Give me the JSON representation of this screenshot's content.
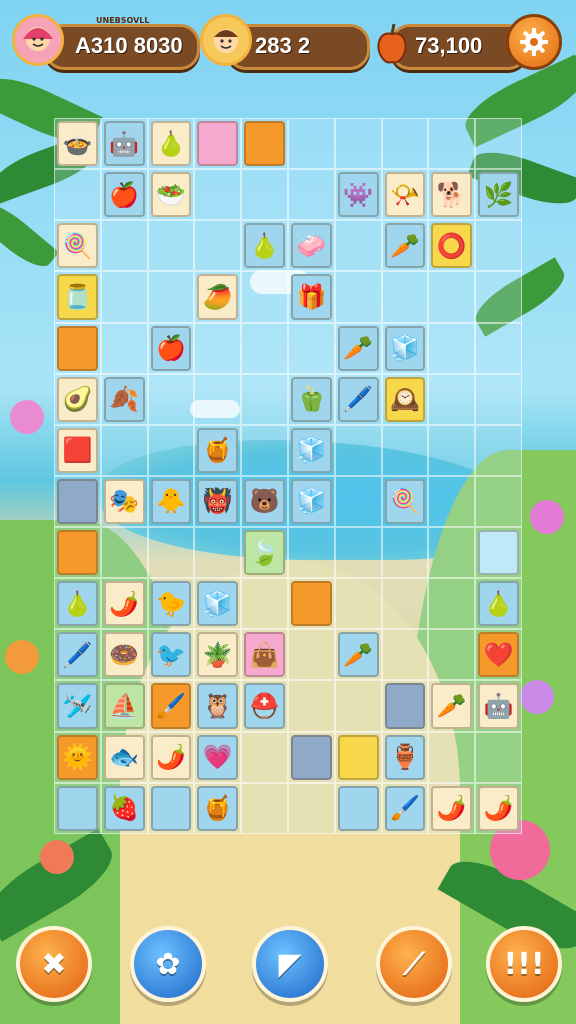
{
  "hud": {
    "player": {
      "score_label": "A310 8030",
      "caption": "UNEBSOVLL"
    },
    "opponent": {
      "score_label": "283 2"
    },
    "coins": {
      "value_label": "73,100"
    }
  },
  "colors": {
    "wood": "#7a4a25",
    "orange": "#f59a2a",
    "blue": "#9fd6ee",
    "pink": "#f6a9cf",
    "cream": "#fbecc9",
    "yellow": "#f6d84a"
  },
  "board": {
    "cols": 10,
    "rows": 14,
    "tiles": [
      {
        "r": 0,
        "c": 0,
        "color": "cream",
        "icon": "pot",
        "glyph": "🍲"
      },
      {
        "r": 0,
        "c": 1,
        "color": "blue",
        "icon": "robot",
        "glyph": "🤖"
      },
      {
        "r": 0,
        "c": 2,
        "color": "cream",
        "icon": "pear",
        "glyph": "🍐"
      },
      {
        "r": 0,
        "c": 3,
        "color": "pink",
        "icon": "blank",
        "glyph": ""
      },
      {
        "r": 0,
        "c": 4,
        "color": "orange",
        "icon": "blank",
        "glyph": ""
      },
      {
        "r": 1,
        "c": 1,
        "color": "blue",
        "icon": "pomegranate",
        "glyph": "🍎"
      },
      {
        "r": 1,
        "c": 2,
        "color": "cream",
        "icon": "bowl",
        "glyph": "🥗"
      },
      {
        "r": 1,
        "c": 6,
        "color": "blue",
        "icon": "monster",
        "glyph": "👾"
      },
      {
        "r": 1,
        "c": 7,
        "color": "cream",
        "icon": "horn",
        "glyph": "📯"
      },
      {
        "r": 1,
        "c": 8,
        "color": "cream",
        "icon": "animal",
        "glyph": "🐕"
      },
      {
        "r": 1,
        "c": 9,
        "color": "blue",
        "icon": "leaf",
        "glyph": "🌿"
      },
      {
        "r": 2,
        "c": 0,
        "color": "cream",
        "icon": "lollipop",
        "glyph": "🍭"
      },
      {
        "r": 2,
        "c": 4,
        "color": "blue",
        "icon": "gourd",
        "glyph": "🍐"
      },
      {
        "r": 2,
        "c": 5,
        "color": "blue",
        "icon": "eraser",
        "glyph": "🧼"
      },
      {
        "r": 2,
        "c": 7,
        "color": "blue",
        "icon": "carrot",
        "glyph": "🥕"
      },
      {
        "r": 2,
        "c": 8,
        "color": "yellow",
        "icon": "ring",
        "glyph": "⭕"
      },
      {
        "r": 3,
        "c": 0,
        "color": "yellow",
        "icon": "jar",
        "glyph": "🫙"
      },
      {
        "r": 3,
        "c": 3,
        "color": "cream",
        "icon": "mango",
        "glyph": "🥭"
      },
      {
        "r": 3,
        "c": 5,
        "color": "blue",
        "icon": "box",
        "glyph": "🎁"
      },
      {
        "r": 4,
        "c": 0,
        "color": "orange",
        "icon": "blank",
        "glyph": ""
      },
      {
        "r": 4,
        "c": 2,
        "color": "blue",
        "icon": "apple",
        "glyph": "🍎"
      },
      {
        "r": 4,
        "c": 6,
        "color": "blue",
        "icon": "carrot",
        "glyph": "🥕"
      },
      {
        "r": 4,
        "c": 7,
        "color": "blue",
        "icon": "cube",
        "glyph": "🧊"
      },
      {
        "r": 5,
        "c": 0,
        "color": "cream",
        "icon": "avocado",
        "glyph": "🥑"
      },
      {
        "r": 5,
        "c": 1,
        "color": "blue",
        "icon": "leaf",
        "glyph": "🍂"
      },
      {
        "r": 5,
        "c": 5,
        "color": "blue",
        "icon": "pepper",
        "glyph": "🫑"
      },
      {
        "r": 5,
        "c": 6,
        "color": "blue",
        "icon": "pen",
        "glyph": "🖊️"
      },
      {
        "r": 5,
        "c": 7,
        "color": "yellow",
        "icon": "clock",
        "glyph": "🕰️"
      },
      {
        "r": 6,
        "c": 0,
        "color": "cream",
        "icon": "cube-red",
        "glyph": "🟥"
      },
      {
        "r": 6,
        "c": 3,
        "color": "blue",
        "icon": "honey",
        "glyph": "🍯"
      },
      {
        "r": 6,
        "c": 5,
        "color": "blue",
        "icon": "cube",
        "glyph": "🧊"
      },
      {
        "r": 7,
        "c": 0,
        "color": "slate",
        "icon": "blank",
        "glyph": ""
      },
      {
        "r": 7,
        "c": 1,
        "color": "cream",
        "icon": "mask",
        "glyph": "🎭"
      },
      {
        "r": 7,
        "c": 2,
        "color": "blue",
        "icon": "bird",
        "glyph": "🐥"
      },
      {
        "r": 7,
        "c": 3,
        "color": "blue",
        "icon": "monster",
        "glyph": "👹"
      },
      {
        "r": 7,
        "c": 4,
        "color": "blue",
        "icon": "creature",
        "glyph": "🐻"
      },
      {
        "r": 7,
        "c": 5,
        "color": "blue",
        "icon": "cube",
        "glyph": "🧊"
      },
      {
        "r": 7,
        "c": 7,
        "color": "blue",
        "icon": "lollipop",
        "glyph": "🍭"
      },
      {
        "r": 8,
        "c": 0,
        "color": "orange",
        "icon": "blank",
        "glyph": ""
      },
      {
        "r": 8,
        "c": 4,
        "color": "green",
        "icon": "leaf",
        "glyph": "🍃"
      },
      {
        "r": 8,
        "c": 9,
        "color": "lblue",
        "icon": "blank",
        "glyph": ""
      },
      {
        "r": 9,
        "c": 0,
        "color": "blue",
        "icon": "pear",
        "glyph": "🍐"
      },
      {
        "r": 9,
        "c": 1,
        "color": "cream",
        "icon": "pepper",
        "glyph": "🌶️"
      },
      {
        "r": 9,
        "c": 2,
        "color": "blue",
        "icon": "chick",
        "glyph": "🐤"
      },
      {
        "r": 9,
        "c": 3,
        "color": "blue",
        "icon": "cube",
        "glyph": "🧊"
      },
      {
        "r": 9,
        "c": 5,
        "color": "orange",
        "icon": "blank",
        "glyph": ""
      },
      {
        "r": 9,
        "c": 9,
        "color": "blue",
        "icon": "pear",
        "glyph": "🍐"
      },
      {
        "r": 10,
        "c": 0,
        "color": "blue",
        "icon": "pen",
        "glyph": "🖊️"
      },
      {
        "r": 10,
        "c": 1,
        "color": "cream",
        "icon": "donut",
        "glyph": "🍩"
      },
      {
        "r": 10,
        "c": 2,
        "color": "blue",
        "icon": "bird",
        "glyph": "🐦"
      },
      {
        "r": 10,
        "c": 3,
        "color": "cream",
        "icon": "plant",
        "glyph": "🪴"
      },
      {
        "r": 10,
        "c": 4,
        "color": "pink",
        "icon": "bag",
        "glyph": "👜"
      },
      {
        "r": 10,
        "c": 6,
        "color": "blue",
        "icon": "carrot",
        "glyph": "🥕"
      },
      {
        "r": 10,
        "c": 9,
        "color": "orange",
        "icon": "heart",
        "glyph": "❤️"
      },
      {
        "r": 11,
        "c": 0,
        "color": "blue",
        "icon": "plane",
        "glyph": "🛩️"
      },
      {
        "r": 11,
        "c": 1,
        "color": "green",
        "icon": "boat",
        "glyph": "⛵"
      },
      {
        "r": 11,
        "c": 2,
        "color": "orange",
        "icon": "brush",
        "glyph": "🖌️"
      },
      {
        "r": 11,
        "c": 3,
        "color": "blue",
        "icon": "owl",
        "glyph": "🦉"
      },
      {
        "r": 11,
        "c": 4,
        "color": "blue",
        "icon": "helmet",
        "glyph": "⛑️"
      },
      {
        "r": 11,
        "c": 7,
        "color": "slate",
        "icon": "blank",
        "glyph": ""
      },
      {
        "r": 11,
        "c": 8,
        "color": "cream",
        "icon": "carrot",
        "glyph": "🥕"
      },
      {
        "r": 11,
        "c": 9,
        "color": "cream",
        "icon": "robot",
        "glyph": "🤖"
      },
      {
        "r": 12,
        "c": 0,
        "color": "orange",
        "icon": "sun",
        "glyph": "🌞"
      },
      {
        "r": 12,
        "c": 1,
        "color": "cream",
        "icon": "bird",
        "glyph": "🐟"
      },
      {
        "r": 12,
        "c": 2,
        "color": "cream",
        "icon": "pepper",
        "glyph": "🌶️"
      },
      {
        "r": 12,
        "c": 3,
        "color": "blue",
        "icon": "heart",
        "glyph": "💗"
      },
      {
        "r": 12,
        "c": 5,
        "color": "slate",
        "icon": "blank",
        "glyph": ""
      },
      {
        "r": 12,
        "c": 6,
        "color": "yellow",
        "icon": "blank",
        "glyph": ""
      },
      {
        "r": 12,
        "c": 7,
        "color": "blue",
        "icon": "jar",
        "glyph": "🏺"
      },
      {
        "r": 13,
        "c": 0,
        "color": "blue",
        "icon": "blank",
        "glyph": ""
      },
      {
        "r": 13,
        "c": 1,
        "color": "blue",
        "icon": "pomegranate",
        "glyph": "🍓"
      },
      {
        "r": 13,
        "c": 2,
        "color": "blue",
        "icon": "blank",
        "glyph": ""
      },
      {
        "r": 13,
        "c": 3,
        "color": "blue",
        "icon": "honey",
        "glyph": "🍯"
      },
      {
        "r": 13,
        "c": 6,
        "color": "blue",
        "icon": "blank",
        "glyph": ""
      },
      {
        "r": 13,
        "c": 7,
        "color": "blue",
        "icon": "brush",
        "glyph": "🖌️"
      },
      {
        "r": 13,
        "c": 8,
        "color": "cream",
        "icon": "pepper",
        "glyph": "🌶️"
      },
      {
        "r": 13,
        "c": 9,
        "color": "cream",
        "icon": "pepper",
        "glyph": "🌶️"
      }
    ]
  },
  "buttons": [
    {
      "name": "shuffle-button",
      "icon": "cross-icon",
      "glyph": "✖",
      "style": "orange"
    },
    {
      "name": "flower-button",
      "icon": "flower-icon",
      "glyph": "✿",
      "style": "blue"
    },
    {
      "name": "hint-button",
      "icon": "flag-icon",
      "glyph": "◤",
      "style": "blue"
    },
    {
      "name": "magic-button",
      "icon": "wand-icon",
      "glyph": "⟋",
      "style": "orange"
    },
    {
      "name": "bonus-button",
      "icon": "exclaim-icon",
      "glyph": "!!!",
      "style": "orange"
    }
  ]
}
